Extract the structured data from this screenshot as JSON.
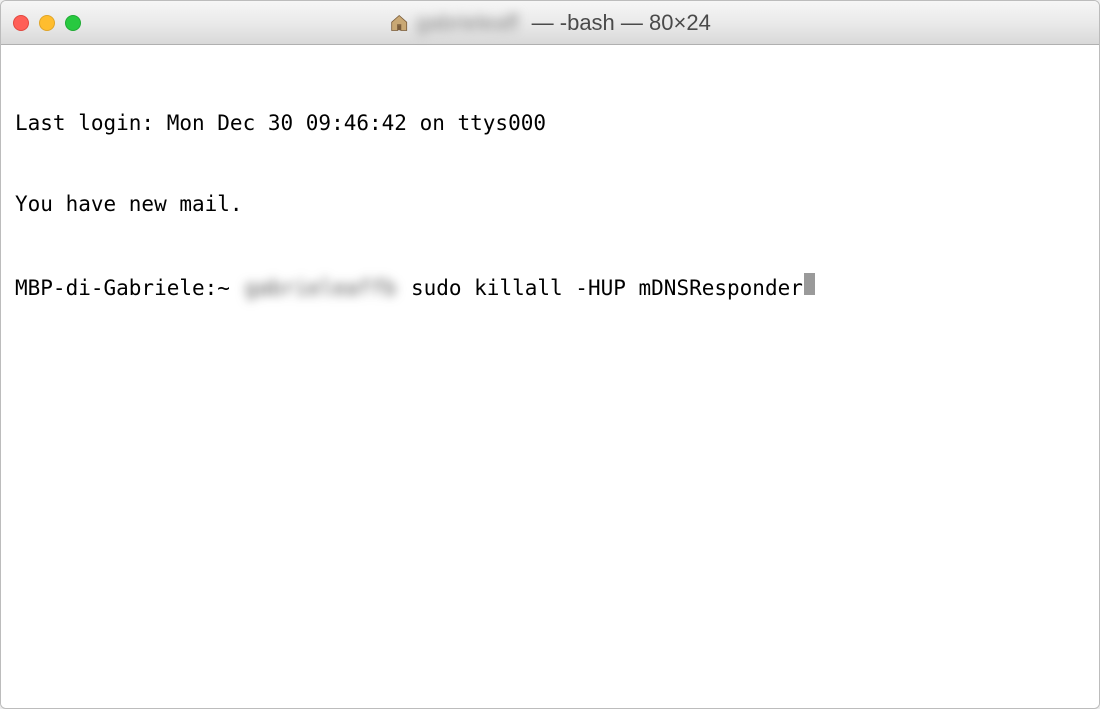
{
  "window": {
    "title_blurred": "gabrieleaff",
    "title_suffix": " — -bash — 80×24"
  },
  "terminal": {
    "line1": "Last login: Mon Dec 30 09:46:42 on ttys000",
    "line2": "You have new mail.",
    "prompt_host": "MBP-di-Gabriele:~ ",
    "prompt_user_blurred": "gabrieleaffb",
    "command": " sudo killall -HUP mDNSResponder"
  }
}
